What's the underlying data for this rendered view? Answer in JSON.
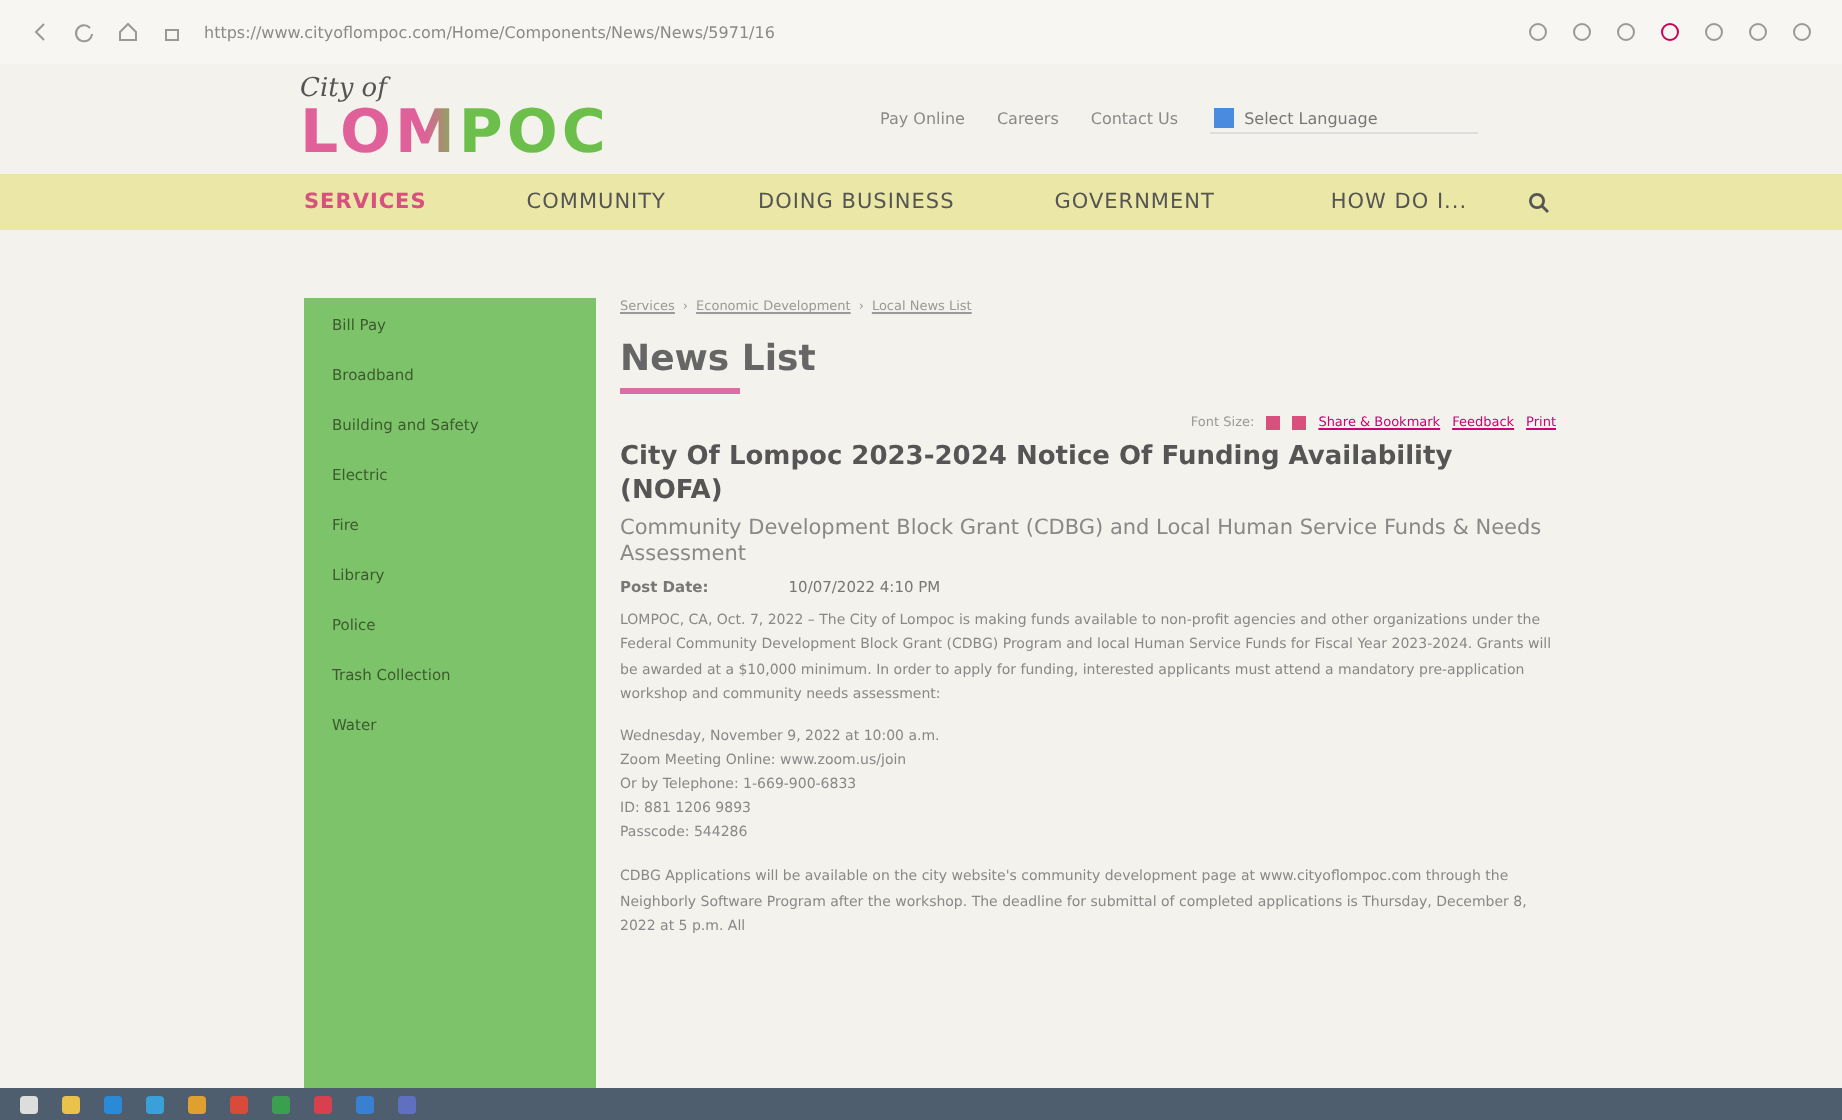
{
  "browser": {
    "url": "https://www.cityoflompoc.com/Home/Components/News/News/5971/16"
  },
  "header": {
    "logo_script": "City of",
    "logo_name": "LOMPOC",
    "links": [
      "Pay Online",
      "Careers",
      "Contact Us"
    ],
    "language": "Select Language"
  },
  "nav": [
    {
      "label": "SERVICES",
      "selected": true
    },
    {
      "label": "COMMUNITY",
      "selected": false
    },
    {
      "label": "DOING BUSINESS",
      "selected": false
    },
    {
      "label": "GOVERNMENT",
      "selected": false
    },
    {
      "label": "HOW DO I...",
      "selected": false
    }
  ],
  "sidebar": {
    "items": [
      "Bill Pay",
      "Broadband",
      "Building and Safety",
      "Electric",
      "Fire",
      "Library",
      "Police",
      "Trash Collection",
      "Water"
    ]
  },
  "breadcrumb": [
    "Services",
    "Economic Development",
    "Local News List"
  ],
  "breadcrumb_separator": "›",
  "page_title": "News List",
  "tools": {
    "label": "Font Size:",
    "links": [
      "Share & Bookmark",
      "Feedback",
      "Print"
    ]
  },
  "article": {
    "title": "City Of Lompoc 2023-2024 Notice Of Funding Availability (NOFA)",
    "subtitle": "Community Development Block Grant (CDBG) and Local Human Service Funds & Needs Assessment",
    "post_date_label": "Post Date:",
    "post_date": "10/07/2022 4:10 PM",
    "intro": "LOMPOC, CA, Oct. 7, 2022 – The City of Lompoc is making funds available to non-profit agencies and other organizations under the Federal Community Development Block Grant (CDBG) Program and local Human Service Funds for Fiscal Year 2023-2024. Grants will be awarded at a $10,000 minimum. In order to apply for funding, interested applicants must attend a mandatory pre-application workshop and community needs assessment:",
    "event_lines": [
      "Wednesday, November 9, 2022 at 10:00 a.m.",
      "Zoom Meeting Online: www.zoom.us/join",
      "Or by Telephone: 1-669-900-6833",
      "ID: 881 1206 9893",
      "Passcode: 544286"
    ],
    "closing": "CDBG Applications will be available on the city website's community development page at www.cityoflompoc.com through the Neighborly Software Program after the workshop. The deadline for submittal of completed applications is Thursday, December 8, 2022 at 5 p.m. All"
  }
}
